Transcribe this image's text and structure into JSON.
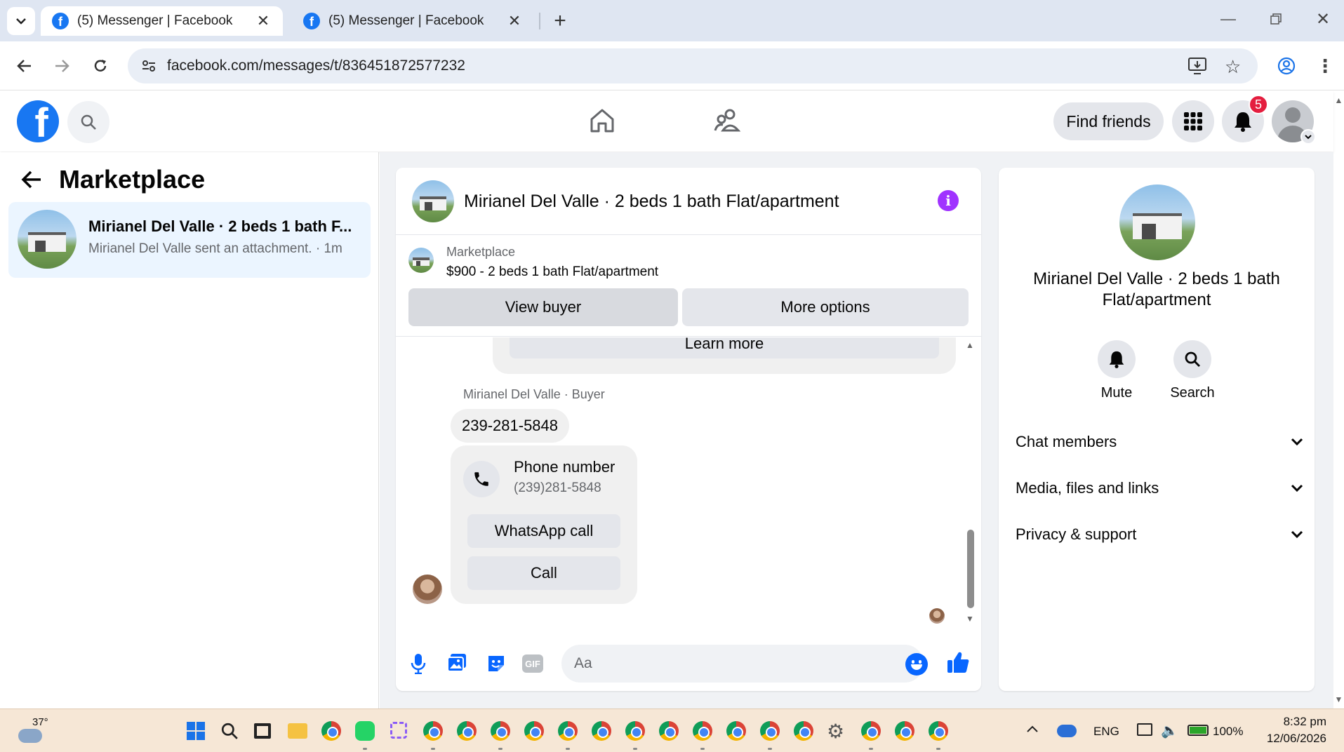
{
  "browser": {
    "tabs": [
      {
        "title": "(5) Messenger | Facebook"
      },
      {
        "title": "(5) Messenger | Facebook"
      }
    ],
    "url": "facebook.com/messages/t/836451872577232"
  },
  "header": {
    "find_friends_label": "Find friends",
    "notification_count": "5"
  },
  "left": {
    "title": "Marketplace",
    "conversation": {
      "name": "Mirianel Del Valle · 2 beds 1 bath F...",
      "preview": "Mirianel Del Valle sent an attachment. · 1m"
    }
  },
  "chat": {
    "title": "Mirianel Del Valle · 2 beds 1 bath Flat/apartment",
    "listing": {
      "source": "Marketplace",
      "summary": "$900 - 2 beds 1 bath Flat/apartment",
      "view_buyer_label": "View buyer",
      "more_options_label": "More options"
    },
    "learn_more_label": "Learn more",
    "sender_label": "Mirianel Del Valle · Buyer",
    "message_text": "239-281-5848",
    "phone_card": {
      "title": "Phone number",
      "number": "(239)281-5848",
      "whatsapp_label": "WhatsApp call",
      "call_label": "Call"
    },
    "composer_placeholder": "Aa",
    "gif_label": "GIF"
  },
  "info": {
    "name": "Mirianel Del Valle · 2 beds 1 bath Flat/apartment",
    "mute_label": "Mute",
    "search_label": "Search",
    "sections": [
      "Chat members",
      "Media, files and links",
      "Privacy & support"
    ]
  },
  "taskbar": {
    "temperature": "37°",
    "language": "ENG",
    "battery": "100%",
    "time": "8:32 pm",
    "date": "12/06/2026"
  },
  "colors": {
    "facebook_blue": "#1877f2",
    "messenger_purple": "#a033ff",
    "notification_red": "#e41e3f"
  }
}
